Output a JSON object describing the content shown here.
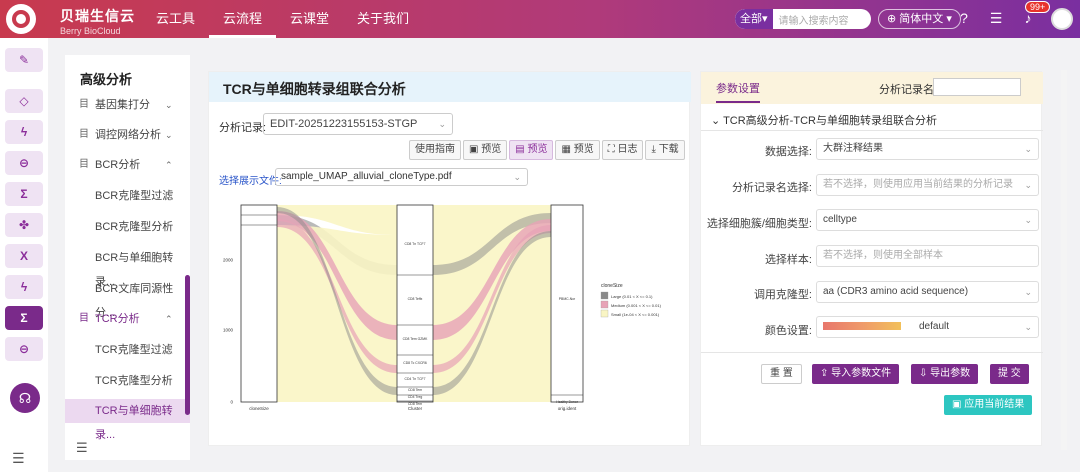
{
  "brand": {
    "name": "贝瑞生信云",
    "sub": "Berry BioCloud"
  },
  "nav": [
    {
      "label": "云工具"
    },
    {
      "label": "云流程"
    },
    {
      "label": "云课堂"
    },
    {
      "label": "关于我们"
    }
  ],
  "search": {
    "scope": "全部▾",
    "placeholder": "请输入搜索内容"
  },
  "lang": "简体中文 ▾",
  "badge": "99+",
  "sidebar": {
    "title": "高级分析",
    "items": [
      {
        "label": "基因集打分",
        "chev": "⌄"
      },
      {
        "label": "调控网络分析",
        "chev": "⌄"
      },
      {
        "label": "BCR分析",
        "chev": "⌃"
      },
      {
        "label": "BCR克隆型过滤"
      },
      {
        "label": "BCR克隆型分析"
      },
      {
        "label": "BCR与单细胞转录..."
      },
      {
        "label": "BCR文库同源性分..."
      },
      {
        "label": "TCR分析",
        "chev": "⌃"
      },
      {
        "label": "TCR克隆型过滤"
      },
      {
        "label": "TCR克隆型分析"
      },
      {
        "label": "TCR与单细胞转录..."
      }
    ]
  },
  "main": {
    "title": "TCR与单细胞转录组联合分析",
    "record_label": "分析记录:",
    "record_value": "EDIT-20251223155153-STGP",
    "toolbar": [
      "使用指南",
      "预览",
      "预览",
      "预览",
      "日志",
      "下载"
    ],
    "file_label": "选择展示文件:",
    "file_value": "sample_UMAP_alluvial_cloneType.pdf"
  },
  "chart_data": {
    "type": "alluvial",
    "axes": [
      "cloneSize",
      "Cluster",
      "orig.ident"
    ],
    "y_ticks": [
      "0",
      "1000",
      "2000"
    ],
    "legend_title": "cloneSize",
    "legend": [
      {
        "label": "Large (0.01 < X <= 0.1)",
        "color": "#8a8a8a"
      },
      {
        "label": "Medium (0.001 < X <= 0.01)",
        "color": "#e7a3b7"
      },
      {
        "label": "Small (1e-04 < X <= 0.001)",
        "color": "#f9f5c4"
      }
    ],
    "clusters": [
      "CD8 Tn TCF7",
      "CD8 Teffx",
      "CD8 Tem GZMK",
      "CD8 Tc CXCR6",
      "CD4 Tn TCF7",
      "CD8 Tem",
      "CD4 Treg",
      "CD8 Tem"
    ],
    "samples": [
      "PBMC-Nor",
      "Healthy Donor"
    ],
    "colors": {
      "large": "#8a8a8a",
      "medium": "#e7a3b7",
      "small": "#f9f5c4"
    }
  },
  "params": {
    "tab": "参数设置",
    "name_label": "分析记录名:",
    "section": "TCR高级分析-TCR与单细胞转录组联合分析",
    "fields": [
      {
        "label": "数据选择:",
        "value": "大群注释结果"
      },
      {
        "label": "分析记录名选择:",
        "value": "若不选择，则使用应用当前结果的分析记录"
      },
      {
        "label": "选择细胞簇/细胞类型:",
        "value": "celltype"
      },
      {
        "label": "选择样本:",
        "value": "若不选择，则使用全部样本"
      },
      {
        "label": "调用克隆型:",
        "value": "aa (CDR3 amino acid sequence)"
      },
      {
        "label": "颜色设置:",
        "value": "default"
      }
    ],
    "buttons": {
      "reset": "重 置",
      "import": "导入参数文件",
      "export": "导出参数",
      "submit": "提 交",
      "apply": "应用当前结果"
    }
  }
}
